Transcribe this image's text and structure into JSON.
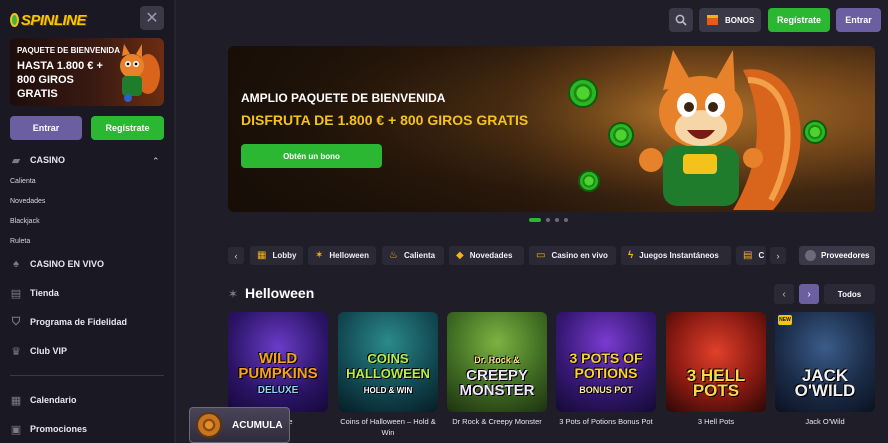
{
  "brand": {
    "logo_text": "SPINLINE"
  },
  "sidebar": {
    "promo": {
      "line1": "PAQUETE DE BIENVENIDA",
      "line2": "HASTA 1.800 € + 800 GIROS GRATIS"
    },
    "entrar_label": "Entrar",
    "registrate_label": "Regístrate",
    "casino_label": "CASINO",
    "casino_sub": [
      "Calienta",
      "Novedades",
      "Blackjack",
      "Ruleta"
    ],
    "items": [
      {
        "label": "CASINO EN VIVO",
        "icon": "live-casino-icon"
      },
      {
        "label": "Tienda",
        "icon": "shop-icon"
      },
      {
        "label": "Programa de Fidelidad",
        "icon": "loyalty-icon"
      },
      {
        "label": "Club VIP",
        "icon": "crown-icon"
      },
      {
        "label": "Calendario",
        "icon": "calendar-icon"
      },
      {
        "label": "Promociones",
        "icon": "promotions-icon"
      }
    ]
  },
  "header": {
    "bonos_label": "BONOS",
    "registrate_label": "Regístrate",
    "entrar_label": "Entrar"
  },
  "banner": {
    "line1": "AMPLIO PAQUETE DE BIENVENIDA",
    "line2": "DISFRUTA DE 1.800 € + 800 GIROS GRATIS",
    "cta": "Obtén un bono",
    "slides": 4,
    "active_slide": 1
  },
  "categories": [
    {
      "label": "Lobby",
      "icon": "lobby-icon"
    },
    {
      "label": "Helloween",
      "icon": "witch-icon"
    },
    {
      "label": "Calienta",
      "icon": "flame-icon"
    },
    {
      "label": "Novedades",
      "icon": "diamond-icon"
    },
    {
      "label": "Casino en vivo",
      "icon": "live-icon"
    },
    {
      "label": "Juegos Instantáneos",
      "icon": "lightning-icon"
    },
    {
      "label": "C",
      "icon": "chest-icon"
    }
  ],
  "providers_label": "Proveedores",
  "section": {
    "title": "Helloween",
    "todos_label": "Todos"
  },
  "games": [
    {
      "name": "Wild Pumpkins Deluxe",
      "caption": "s Deluxe",
      "art": "WILD PUMPKINS",
      "art_sub": "DELUXE",
      "new": false
    },
    {
      "name": "Coins of Halloween – Hold & Win",
      "caption": "Coins of Halloween – Hold & Win",
      "art": "COINS HALLOWEEN",
      "art_sub": "HOLD & WIN",
      "new": false
    },
    {
      "name": "Dr Rock & Creepy Monster",
      "caption": "Dr Rock & Creepy Monster",
      "art": "CREEPY MONSTER",
      "art_sub": "Dr. Rock &",
      "new": false
    },
    {
      "name": "3 Pots of Potions Bonus Pot",
      "caption": "3 Pots of Potions Bonus Pot",
      "art": "3 POTS OF POTIONS",
      "art_sub": "BONUS POT",
      "new": false
    },
    {
      "name": "3 Hell Pots",
      "caption": "3 Hell Pots",
      "art": "3 HELL POTS",
      "art_sub": "",
      "new": false
    },
    {
      "name": "Jack O'Wild",
      "caption": "Jack O'Wild",
      "art": "JACK O'WILD",
      "art_sub": "",
      "new": true,
      "new_label": "NEW"
    }
  ],
  "acumula_label": "ACUMULA"
}
